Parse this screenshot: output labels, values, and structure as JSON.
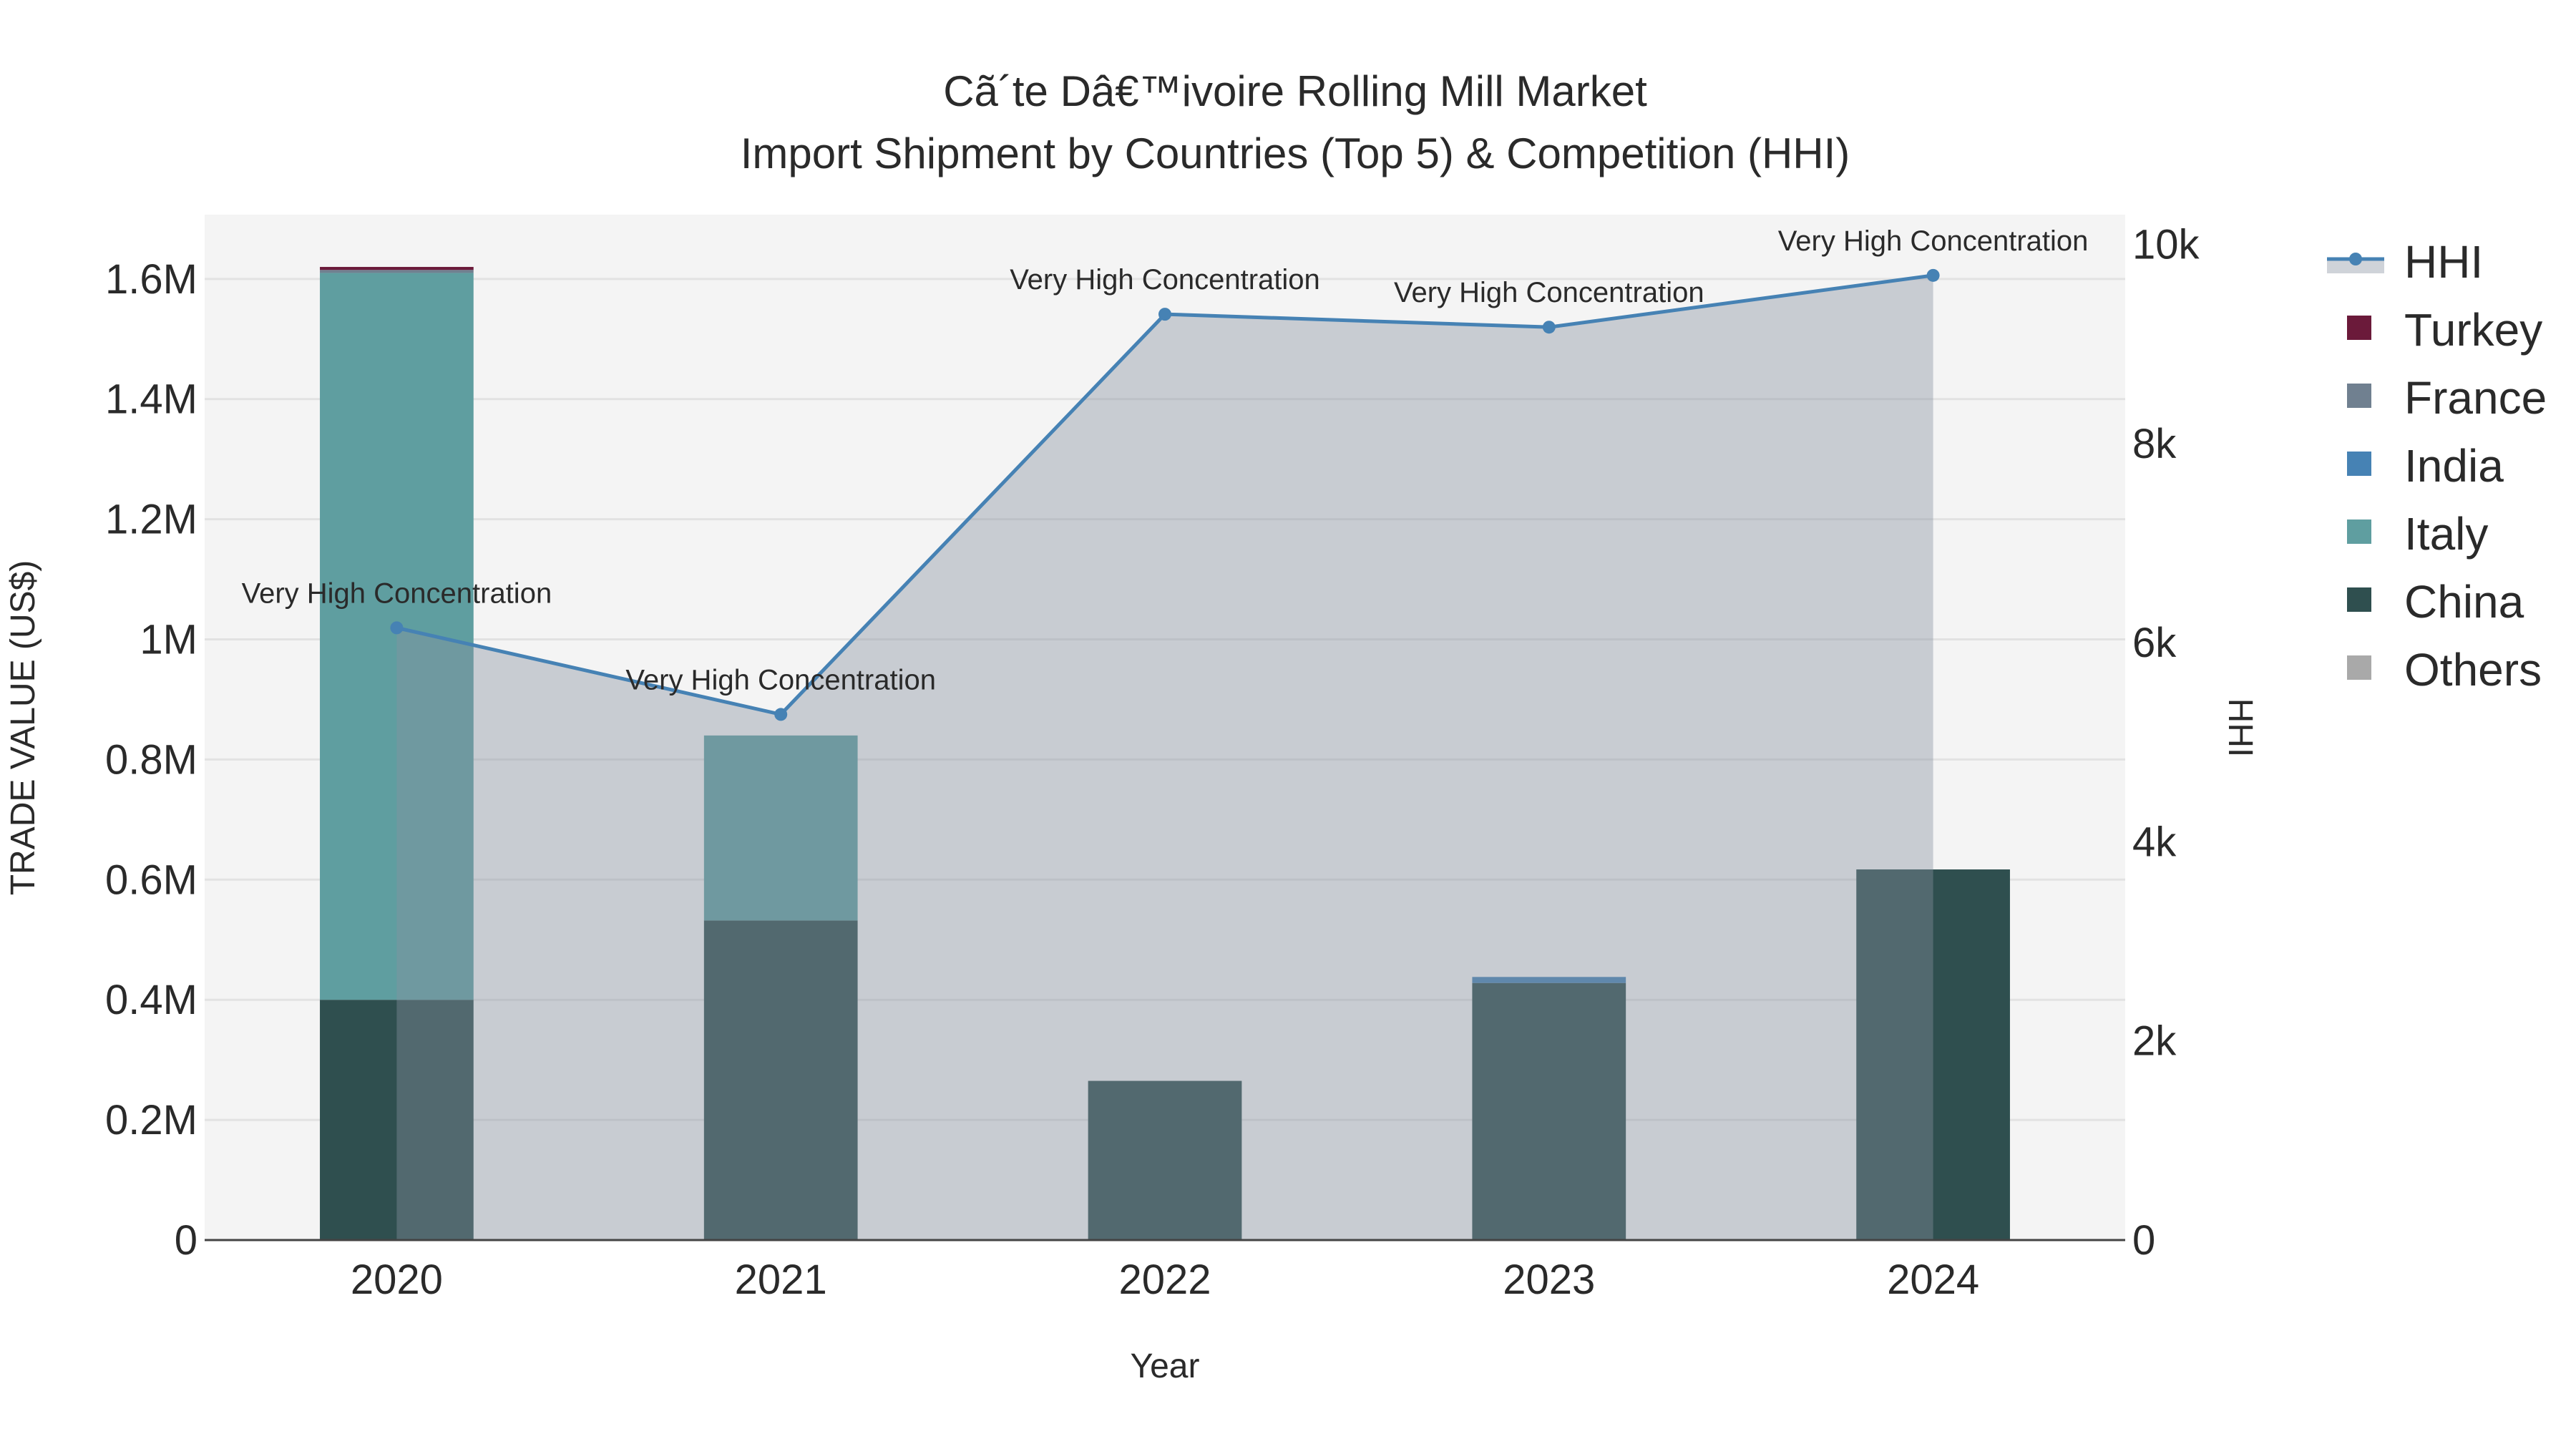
{
  "chart_data": {
    "type": "bar",
    "title": "Cã´te Dâ€™ivoire Rolling Mill Market",
    "subtitle": "Import Shipment by Countries (Top 5) & Competition (HHI)",
    "xlabel": "Year",
    "ylabel": "TRADE VALUE (US$)",
    "y2label": "HHI",
    "categories": [
      "2020",
      "2021",
      "2022",
      "2023",
      "2024"
    ],
    "ylim": [
      0,
      1707000
    ],
    "y2lim": [
      0,
      10300
    ],
    "yticks": [
      0,
      200000,
      400000,
      600000,
      800000,
      1000000,
      1200000,
      1400000,
      1600000
    ],
    "ytick_labels": [
      "0",
      "0.2M",
      "0.4M",
      "0.6M",
      "0.8M",
      "1M",
      "1.2M",
      "1.4M",
      "1.6M"
    ],
    "y2ticks": [
      0,
      2000,
      4000,
      6000,
      8000,
      10000
    ],
    "y2tick_labels": [
      "0",
      "2k",
      "4k",
      "6k",
      "8k",
      "10k"
    ],
    "grid": true,
    "legend_placement": "right",
    "series": [
      {
        "name": "China",
        "color": "#2f4f4f",
        "values": [
          400000,
          532000,
          265000,
          428000,
          617000
        ]
      },
      {
        "name": "Italy",
        "color": "#5f9ea0",
        "values": [
          1210000,
          308000,
          0,
          0,
          0
        ]
      },
      {
        "name": "India",
        "color": "#4682b4",
        "values": [
          0,
          0,
          0,
          10000,
          0
        ]
      },
      {
        "name": "France",
        "color": "#708090",
        "values": [
          5000,
          0,
          0,
          0,
          0
        ]
      },
      {
        "name": "Turkey",
        "color": "#6b1a3a",
        "values": [
          5000,
          0,
          0,
          0,
          0
        ]
      },
      {
        "name": "Others",
        "color": "#a9a9a9",
        "values": [
          0,
          0,
          0,
          0,
          0
        ]
      }
    ],
    "hhi": {
      "name": "HHI",
      "color": "#4682b4",
      "values": [
        6150,
        5280,
        9300,
        9170,
        9690
      ],
      "annotations": [
        "Very High Concentration",
        "Very High Concentration",
        "Very High Concentration",
        "Very High Concentration",
        "Very High Concentration"
      ]
    },
    "legend_order": [
      "HHI",
      "Turkey",
      "France",
      "India",
      "Italy",
      "China",
      "Others"
    ]
  }
}
